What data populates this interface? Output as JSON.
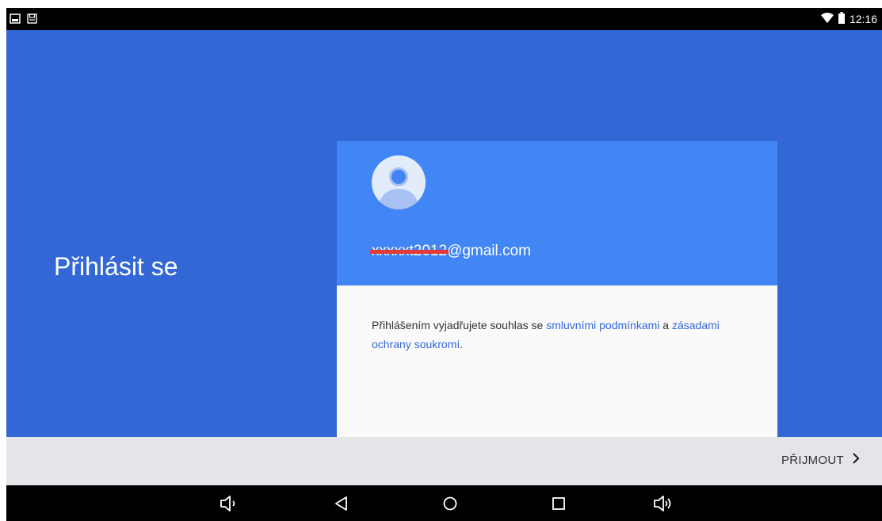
{
  "status_bar": {
    "time": "12:16"
  },
  "signin": {
    "title": "Přihlásit se"
  },
  "account": {
    "email_redacted": "xxxxxt2012",
    "email_domain": "@gmail.com"
  },
  "terms": {
    "prefix": "Přihlášením vyjadřujete souhlas se ",
    "terms_link": "smluvními podmínkami",
    "middle": " a ",
    "privacy_link": "zásadami ochrany soukromí",
    "suffix": "."
  },
  "actions": {
    "accept_label": "PŘIJMOUT"
  },
  "colors": {
    "background_blue": "#3367d6",
    "card_header_blue": "#4285f4",
    "link_blue": "#3367d6",
    "action_bar": "#e3e5e8"
  },
  "icons": {
    "status_left": [
      "image-icon",
      "save-icon"
    ],
    "status_right": [
      "wifi-icon",
      "battery-icon"
    ],
    "navigation": [
      "volume-down-icon",
      "back-icon",
      "home-icon",
      "recents-icon",
      "volume-up-icon"
    ]
  }
}
